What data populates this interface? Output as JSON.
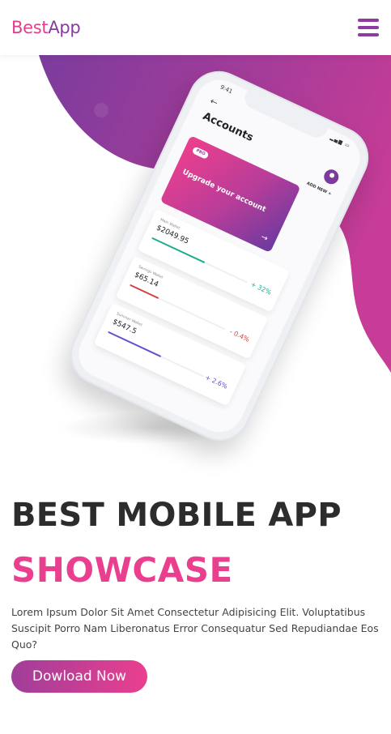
{
  "header": {
    "logo_part1": "Best",
    "logo_part2": "App",
    "menu_icon": "hamburger-menu-icon"
  },
  "phone": {
    "time": "9:41",
    "screen_title": "Accounts",
    "add_new": "ADD NEW +",
    "promo": {
      "badge": "PRO",
      "text": "Upgrade your account",
      "arrow": "→"
    },
    "cards": [
      {
        "name": "Main Wallet",
        "amount": "$2049.95",
        "change": "+ 32%",
        "color": "#1fae8f",
        "fill": 0.55
      },
      {
        "name": "Savings Wallet",
        "amount": "$65.14",
        "change": "- 0.4%",
        "color": "#d64040",
        "fill": 0.3
      },
      {
        "name": "Summer Wallet",
        "amount": "$547.5",
        "change": "+ 2.6%",
        "color": "#6b4fd0",
        "fill": 0.55
      }
    ]
  },
  "main": {
    "title_line1": "BEST MOBILE APP",
    "title_line2": "SHOWCASE",
    "description": "Lorem Ipsum Dolor Sit Amet Consectetur Adipisicing Elit. Voluptatibus Suscipit Porro Nam Liberonatus Error Consequatur Sed Repudiandae Eos Quo?",
    "cta_label": "Dowload Now"
  },
  "colors": {
    "pink": "#ea3e8f",
    "purple": "#8a3aa0"
  }
}
